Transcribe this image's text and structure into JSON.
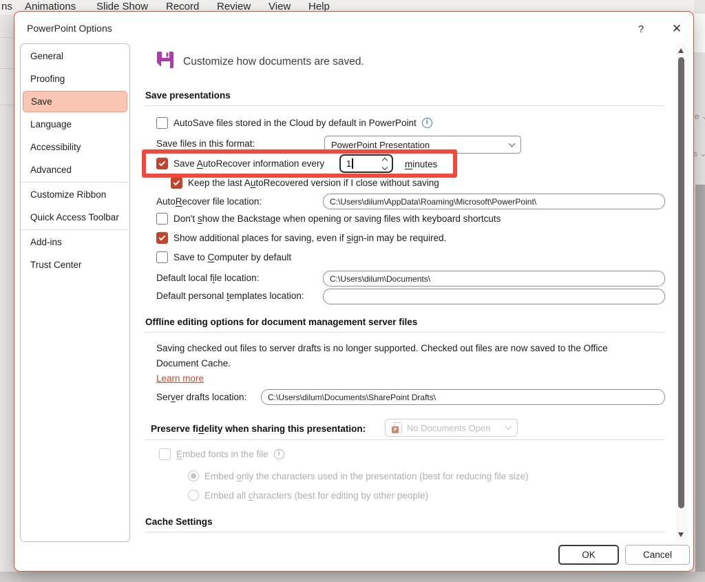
{
  "page": {
    "menubar": {
      "items": [
        "ns",
        "Animations",
        "Slide Show",
        "Record",
        "Review",
        "View",
        "Help"
      ]
    },
    "background_fragments": {
      "frag1": "e",
      "frag2": "s"
    }
  },
  "dialog": {
    "title": "PowerPoint Options",
    "titlebar": {
      "help": "?",
      "close": "✕"
    },
    "sidebar": {
      "items": [
        {
          "label": "General"
        },
        {
          "label": "Proofing"
        },
        {
          "label": "Save",
          "selected": true
        },
        {
          "label": "Language"
        },
        {
          "label": "Accessibility"
        },
        {
          "label": "Advanced"
        },
        {
          "label": "Customize Ribbon"
        },
        {
          "label": "Quick Access Toolbar"
        },
        {
          "label": "Add-ins"
        },
        {
          "label": "Trust Center"
        }
      ]
    },
    "header": {
      "text": "Customize how documents are saved."
    },
    "save_section": {
      "heading": "Save presentations",
      "autosave_cloud_label": "AutoSave files stored in the Cloud by default in PowerPoint",
      "save_format_label": "Save files in this format:",
      "save_format_value": "PowerPoint Presentation",
      "autorecover_label": [
        "Save ",
        "A",
        "utoRecover information every"
      ],
      "autorecover_value": "1",
      "minutes_label": [
        "",
        "m",
        "inutes"
      ],
      "keep_last_label": [
        "Keep the last A",
        "u",
        "toRecovered version if I close without saving"
      ],
      "autorecover_location_label": [
        "Auto",
        "R",
        "ecover file location:"
      ],
      "autorecover_location_value": "C:\\Users\\dilum\\AppData\\Roaming\\Microsoft\\PowerPoint\\",
      "dont_show_label": [
        "Don't ",
        "s",
        "how the Backstage when opening or saving files with keyboard shortcuts"
      ],
      "show_additional_label": [
        "Show additional places for saving, even if ",
        "s",
        "ign-in may be required."
      ],
      "save_computer_label": [
        "Save to ",
        "C",
        "omputer by default"
      ],
      "default_local_label": [
        "Default local f",
        "i",
        "le location:"
      ],
      "default_local_value": "C:\\Users\\dilum\\Documents\\",
      "default_templates_label": [
        "Default personal ",
        "t",
        "emplates location:"
      ],
      "default_templates_value": ""
    },
    "offline_section": {
      "heading": "Offline editing options for document management server files",
      "body": "Saving checked out files to server drafts is no longer supported. Checked out files are now saved to the Office Document Cache.",
      "learn_more": "Learn more",
      "server_drafts_label": [
        "Ser",
        "v",
        "er drafts location:"
      ],
      "server_drafts_value": "C:\\Users\\dilum\\Documents\\SharePoint Drafts\\"
    },
    "fidelity_section": {
      "label": [
        "Preserve fi",
        "d",
        "elity when sharing this presentation:"
      ],
      "dropdown_value": "No Documents Open",
      "embed_fonts_label": [
        "",
        "E",
        "mbed fonts in the file"
      ],
      "embed_only_label": [
        "Embed ",
        "o",
        "nly the characters used in the presentation (best for reducing file size)"
      ],
      "embed_all_label": [
        "Embed all ",
        "c",
        "haracters (best for editing by other people)"
      ]
    },
    "cache_section": {
      "heading": "Cache Settings"
    },
    "footer": {
      "ok": "OK",
      "cancel": "Cancel"
    }
  },
  "colors": {
    "dialog_border": "#E0512D",
    "highlight_box": "#F4483A",
    "checkbox_checked": "#C0452C",
    "sidebar_selected_bg": "#F8C6B3",
    "sidebar_selected_border": "#EE9E85",
    "link": "#C74A2F",
    "save_icon": "#AB3FA9"
  }
}
